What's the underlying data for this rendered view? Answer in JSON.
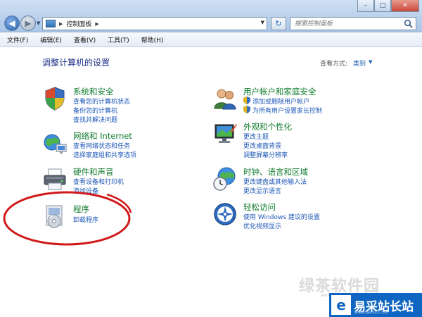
{
  "window": {
    "breadcrumb": "控制面板",
    "search_placeholder": "搜索控制面板",
    "controls": {
      "minimize": "–",
      "maximize": "□",
      "close": "✕"
    }
  },
  "menu": {
    "items": [
      {
        "label": "文件(F)"
      },
      {
        "label": "编辑(E)"
      },
      {
        "label": "查看(V)"
      },
      {
        "label": "工具(T)"
      },
      {
        "label": "帮助(H)"
      }
    ]
  },
  "main": {
    "heading": "调整计算机的设置",
    "view_by_label": "查看方式:",
    "view_by_value": "类别"
  },
  "categories": {
    "system": {
      "title": "系统和安全",
      "icon": "system-security-shield-icon",
      "links": [
        "查看您的计算机状态",
        "备份您的计算机",
        "查找并解决问题"
      ]
    },
    "network": {
      "title": "网络和 Internet",
      "icon": "network-globe-icon",
      "links": [
        "查看网络状态和任务",
        "选择家庭组和共享选项"
      ]
    },
    "hardware": {
      "title": "硬件和声音",
      "icon": "printer-icon",
      "links": [
        "查看设备和打印机",
        "添加设备"
      ]
    },
    "programs": {
      "title": "程序",
      "icon": "programs-disk-icon",
      "links": [
        "卸载程序"
      ]
    },
    "users": {
      "title": "用户帐户和家庭安全",
      "icon": "users-icon",
      "links": [
        "添加或删除用户帐户",
        "为所有用户设置家长控制"
      ]
    },
    "appearance": {
      "title": "外观和个性化",
      "icon": "display-appearance-icon",
      "links": [
        "更改主题",
        "更改桌面背景",
        "调整屏幕分辨率"
      ]
    },
    "clock": {
      "title": "时钟、语言和区域",
      "icon": "clock-globe-icon",
      "links": [
        "更改键盘或其他输入法",
        "更改显示语言"
      ]
    },
    "ease": {
      "title": "轻松访问",
      "icon": "ease-of-access-icon",
      "links": [
        "使用 Windows 建议的设置",
        "优化视频显示"
      ]
    }
  },
  "watermark": {
    "text": "绿茶软件园",
    "url": "www.33lc.com",
    "brand": "易采站长站",
    "brand_sub": "Www.EasckCn.Com"
  },
  "colors": {
    "category_title": "#0c7a2a",
    "link": "#1e58b8",
    "heading": "#1e3287",
    "annotation": "#d0191b",
    "brand": "#0f66c2"
  }
}
